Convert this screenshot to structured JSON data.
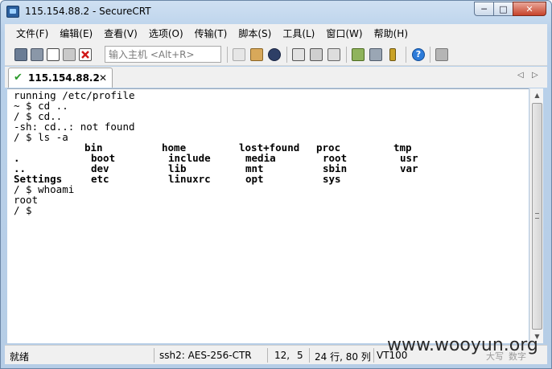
{
  "window": {
    "title": "115.154.88.2 - SecureCRT"
  },
  "window_controls": {
    "minimize": "─",
    "maximize": "□",
    "close": "✕"
  },
  "menu": [
    "文件(F)",
    "编辑(E)",
    "查看(V)",
    "选项(O)",
    "传输(T)",
    "脚本(S)",
    "工具(L)",
    "窗口(W)",
    "帮助(H)"
  ],
  "toolbar": {
    "quick_connect_placeholder": "输入主机 <Alt+R>",
    "icons": [
      "connect-icon",
      "quick-connect-icon",
      "connect-tab-icon",
      "reconnect-icon",
      "disconnect-icon",
      "copy-icon",
      "paste-icon",
      "find-icon",
      "print-icon",
      "print-setup-icon",
      "session-options-icon",
      "global-options-icon",
      "key-agent-icon",
      "help-icon",
      "sftp-icon"
    ]
  },
  "tab": {
    "label": "115.154.88.2",
    "close": "✕",
    "status_icon": "✔",
    "prev": "◁",
    "next": "▷"
  },
  "terminal": {
    "lines": [
      "running /etc/profile",
      "~ $ cd ..",
      "/ $ cd..",
      "-sh: cd..: not found",
      "/ $ ls -a",
      "",
      "",
      "",
      "",
      "/ $ whoami",
      "root",
      "/ $"
    ],
    "ls_cells": [
      [
        "",
        "bin",
        "home",
        "lost+found",
        "proc",
        "tmp"
      ],
      [
        "",
        "boot",
        "include",
        "media",
        "root",
        "usr"
      ],
      [
        "..",
        "dev",
        "lib",
        "mnt",
        "sbin",
        "var"
      ],
      [
        "Settings",
        "etc",
        "linuxrc",
        "opt",
        "sys",
        ""
      ]
    ],
    "ls_row0_dot": "."
  },
  "statusbar": {
    "ready": "就绪",
    "cipher": "ssh2: AES-256-CTR",
    "row": "12,",
    "col": "5",
    "size": "24 行, 80 列",
    "term": "VT100",
    "caps": "大写",
    "num": "数字"
  },
  "watermark": "www.wooyun.org"
}
